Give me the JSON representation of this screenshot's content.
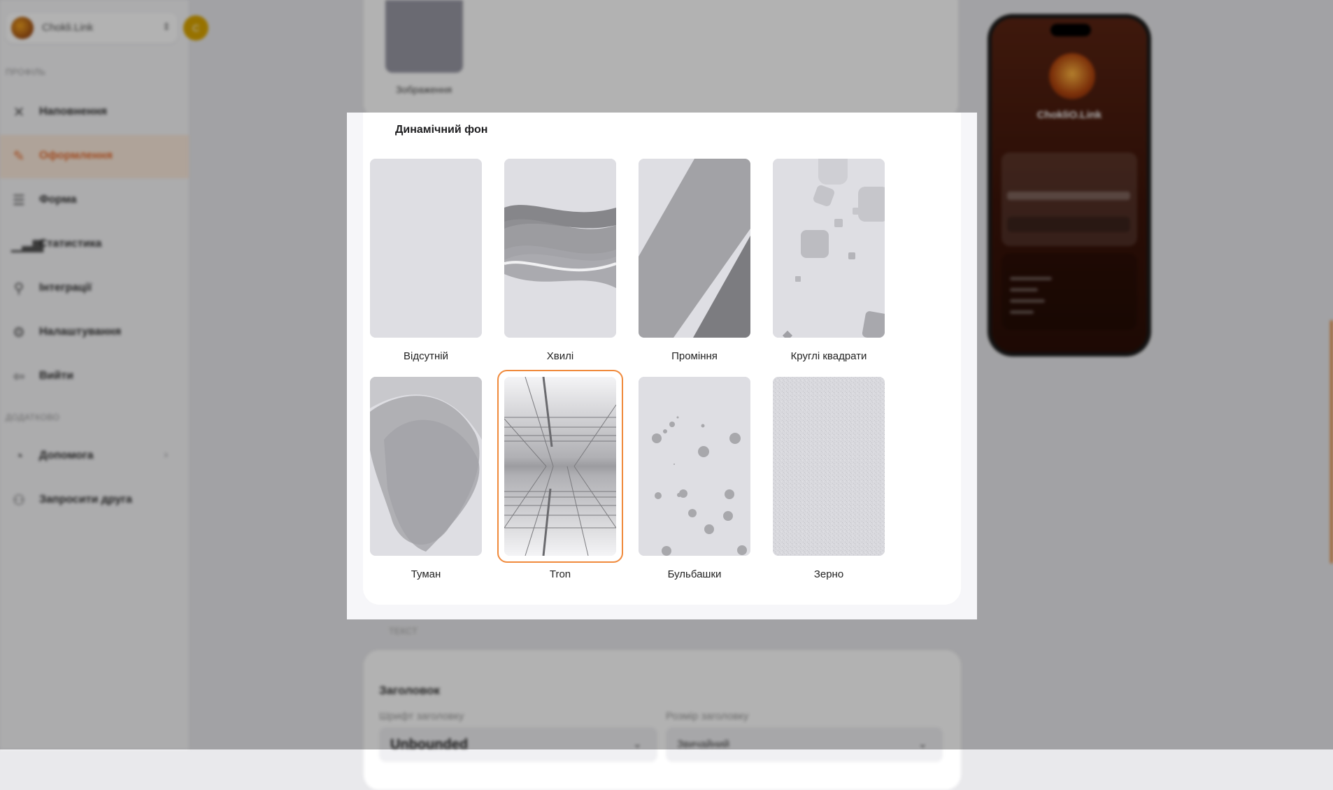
{
  "sidebar": {
    "profile_name": "Chokli.Link",
    "coin_label": "C",
    "section_profile": "ПРОФІЛЬ",
    "section_extra": "ДОДАТКОВО",
    "items": [
      {
        "label": "Наповнення",
        "icon": "tools-icon"
      },
      {
        "label": "Оформлення",
        "icon": "brush-icon",
        "active": true
      },
      {
        "label": "Форма",
        "icon": "form-icon"
      },
      {
        "label": "Статистика",
        "icon": "stats-icon"
      },
      {
        "label": "Інтеграції",
        "icon": "integrations-icon"
      },
      {
        "label": "Налаштування",
        "icon": "gear-icon"
      },
      {
        "label": "Вийти",
        "icon": "logout-icon"
      }
    ],
    "extra_items": [
      {
        "label": "Допомога",
        "icon": "help-icon"
      },
      {
        "label": "Запросити друга",
        "icon": "invite-icon"
      }
    ]
  },
  "background": {
    "image_label": "Зображення",
    "text_section": "ТЕКСТ",
    "heading_card_title": "Заголовок",
    "heading_font_label": "Шрифт заголовку",
    "heading_font_value": "Unbounded",
    "heading_size_label": "Розмір заголовку",
    "heading_size_value": "Звичайний"
  },
  "phone_preview": {
    "name": "ChokliO.Link"
  },
  "dialog": {
    "title": "Динамічний фон",
    "selected": "Tron",
    "options": [
      {
        "id": "none",
        "label": "Відсутній"
      },
      {
        "id": "waves",
        "label": "Хвилі"
      },
      {
        "id": "rays",
        "label": "Проміння"
      },
      {
        "id": "rounded-squares",
        "label": "Круглі квадрати"
      },
      {
        "id": "fog",
        "label": "Туман"
      },
      {
        "id": "tron",
        "label": "Tron"
      },
      {
        "id": "bubbles",
        "label": "Бульбашки"
      },
      {
        "id": "grain",
        "label": "Зерно"
      }
    ]
  },
  "colors": {
    "accent": "#f08a3c",
    "active_bg": "#fbeadb"
  }
}
